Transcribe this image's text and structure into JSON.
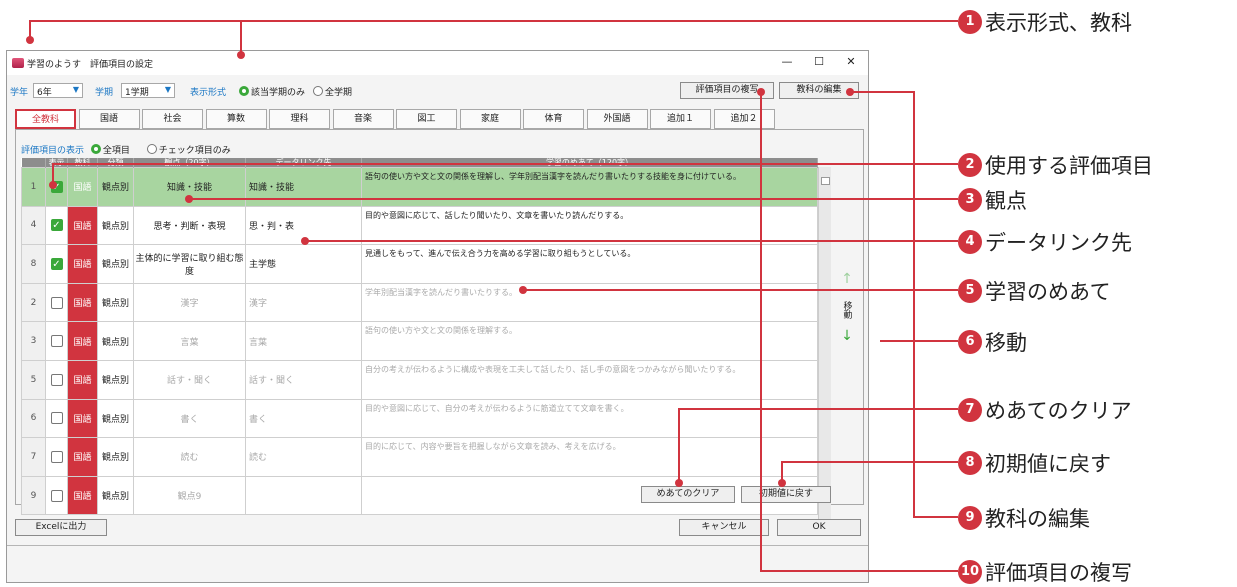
{
  "window": {
    "title": "学習のようす　評価項目の設定",
    "min": "—",
    "max": "☐",
    "close": "✕"
  },
  "toolbar": {
    "grade_label": "学年",
    "grade_value": "6年",
    "term_label": "学期",
    "term_value": "1学期",
    "format_label": "表示形式",
    "format_opt1": "該当学期のみ",
    "format_opt2": "全学期",
    "copy_button": "評価項目の複写",
    "edit_button": "教科の編集"
  },
  "tabs": [
    "全教科",
    "国語",
    "社会",
    "算数",
    "理科",
    "音楽",
    "図工",
    "家庭",
    "体育",
    "外国語",
    "追加１",
    "追加２"
  ],
  "filter": {
    "label": "評価項目の表示",
    "opt1": "全項目",
    "opt2": "チェック項目のみ"
  },
  "columns": {
    "show": "表示",
    "subject": "教科",
    "kind": "分類",
    "view": "観点（20字）",
    "link": "データリンク先",
    "goal": "学習のめあて（120字）"
  },
  "rows": [
    {
      "no": "1",
      "checked": true,
      "subject": "国語",
      "kind": "観点別",
      "view": "知識・技能",
      "link": "知識・技能",
      "goal": "語句の使い方や文と文の関係を理解し、学年別配当漢字を読んだり書いたりする技能を身に付けている。",
      "hl": true,
      "dim": false
    },
    {
      "no": "4",
      "checked": true,
      "subject": "国語",
      "kind": "観点別",
      "view": "思考・判断・表現",
      "link": "思・判・表",
      "goal": "目的や意図に応じて、話したり聞いたり、文章を書いたり読んだりする。",
      "hl": false,
      "dim": false
    },
    {
      "no": "8",
      "checked": true,
      "subject": "国語",
      "kind": "観点別",
      "view": "主体的に学習に取り組む態度",
      "link": "主学態",
      "goal": "見通しをもって、進んで伝え合う力を高める学習に取り組もうとしている。",
      "hl": false,
      "dim": false
    },
    {
      "no": "2",
      "checked": false,
      "subject": "国語",
      "kind": "観点別",
      "view": "漢字",
      "link": "漢字",
      "goal": "学年別配当漢字を読んだり書いたりする。",
      "hl": false,
      "dim": true
    },
    {
      "no": "3",
      "checked": false,
      "subject": "国語",
      "kind": "観点別",
      "view": "言葉",
      "link": "言葉",
      "goal": "語句の使い方や文と文の関係を理解する。",
      "hl": false,
      "dim": true
    },
    {
      "no": "5",
      "checked": false,
      "subject": "国語",
      "kind": "観点別",
      "view": "話す・聞く",
      "link": "話す・聞く",
      "goal": "自分の考えが伝わるように構成や表現を工夫して話したり、話し手の意図をつかみながら聞いたりする。",
      "hl": false,
      "dim": true
    },
    {
      "no": "6",
      "checked": false,
      "subject": "国語",
      "kind": "観点別",
      "view": "書く",
      "link": "書く",
      "goal": "目的や意図に応じて、自分の考えが伝わるように筋道立てて文章を書く。",
      "hl": false,
      "dim": true
    },
    {
      "no": "7",
      "checked": false,
      "subject": "国語",
      "kind": "観点別",
      "view": "読む",
      "link": "読む",
      "goal": "目的に応じて、内容や要旨を把握しながら文章を読み、考えを広げる。",
      "hl": false,
      "dim": true
    },
    {
      "no": "9",
      "checked": false,
      "subject": "国語",
      "kind": "観点別",
      "view": "観点9",
      "link": "",
      "goal": "",
      "hl": false,
      "dim": true
    }
  ],
  "move": {
    "up": "↑",
    "label": "移動",
    "down": "↓"
  },
  "bottom": {
    "clear_goal": "めあてのクリア",
    "reset": "初期値に戻す",
    "excel": "Excelに出力",
    "cancel": "キャンセル",
    "ok": "OK"
  },
  "callouts": [
    {
      "num": "1",
      "text": "表示形式、教科"
    },
    {
      "num": "2",
      "text": "使用する評価項目"
    },
    {
      "num": "3",
      "text": "観点"
    },
    {
      "num": "4",
      "text": "データリンク先"
    },
    {
      "num": "5",
      "text": "学習のめあて"
    },
    {
      "num": "6",
      "text": "移動"
    },
    {
      "num": "7",
      "text": "めあてのクリア"
    },
    {
      "num": "8",
      "text": "初期値に戻す"
    },
    {
      "num": "9",
      "text": "教科の編集"
    },
    {
      "num": "10",
      "text": "評価項目の複写"
    }
  ],
  "colors": {
    "accent": "#d1343f",
    "green": "#3aa83a",
    "highlight": "#a8d5a0"
  }
}
